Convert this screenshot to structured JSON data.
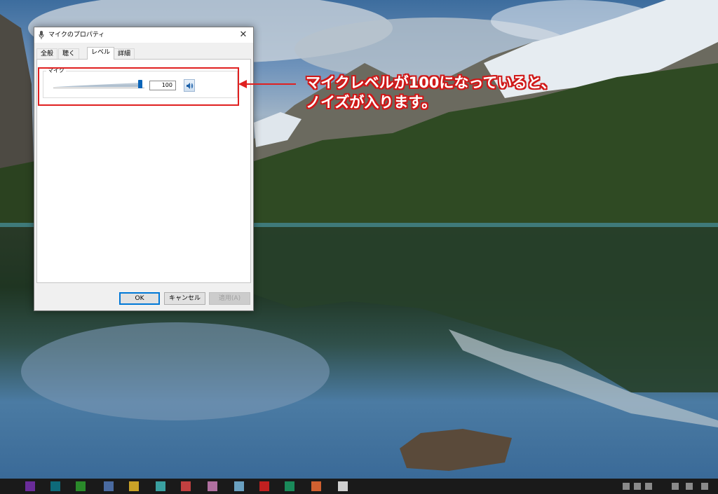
{
  "dialog": {
    "title": "マイクのプロパティ",
    "close_glyph": "✕",
    "tabs": [
      {
        "label": "全般"
      },
      {
        "label": "聴く"
      },
      {
        "label": "レベル",
        "active": true
      },
      {
        "label": "詳細"
      }
    ],
    "level_group": {
      "label": "マイク",
      "value_text": "100",
      "level_fraction": 1.0
    },
    "buttons": {
      "ok": "OK",
      "cancel": "キャンセル",
      "apply": "適用(A)"
    }
  },
  "annotation": {
    "line1": "マイクレベルが100になっていると、",
    "line2": "ノイズが入ります。",
    "color": "#d01818"
  },
  "taskbar": {
    "icon_colors": [
      "#6a2c9a",
      "#0e6a7a",
      "#2a8a2a",
      "#4a6aa0",
      "#c9a227",
      "#3aa0a0",
      "#c04040",
      "#b070a0",
      "#6aa0c0",
      "#c02020",
      "#1a8a5a",
      "#d06030",
      "#cfcfcf"
    ]
  }
}
